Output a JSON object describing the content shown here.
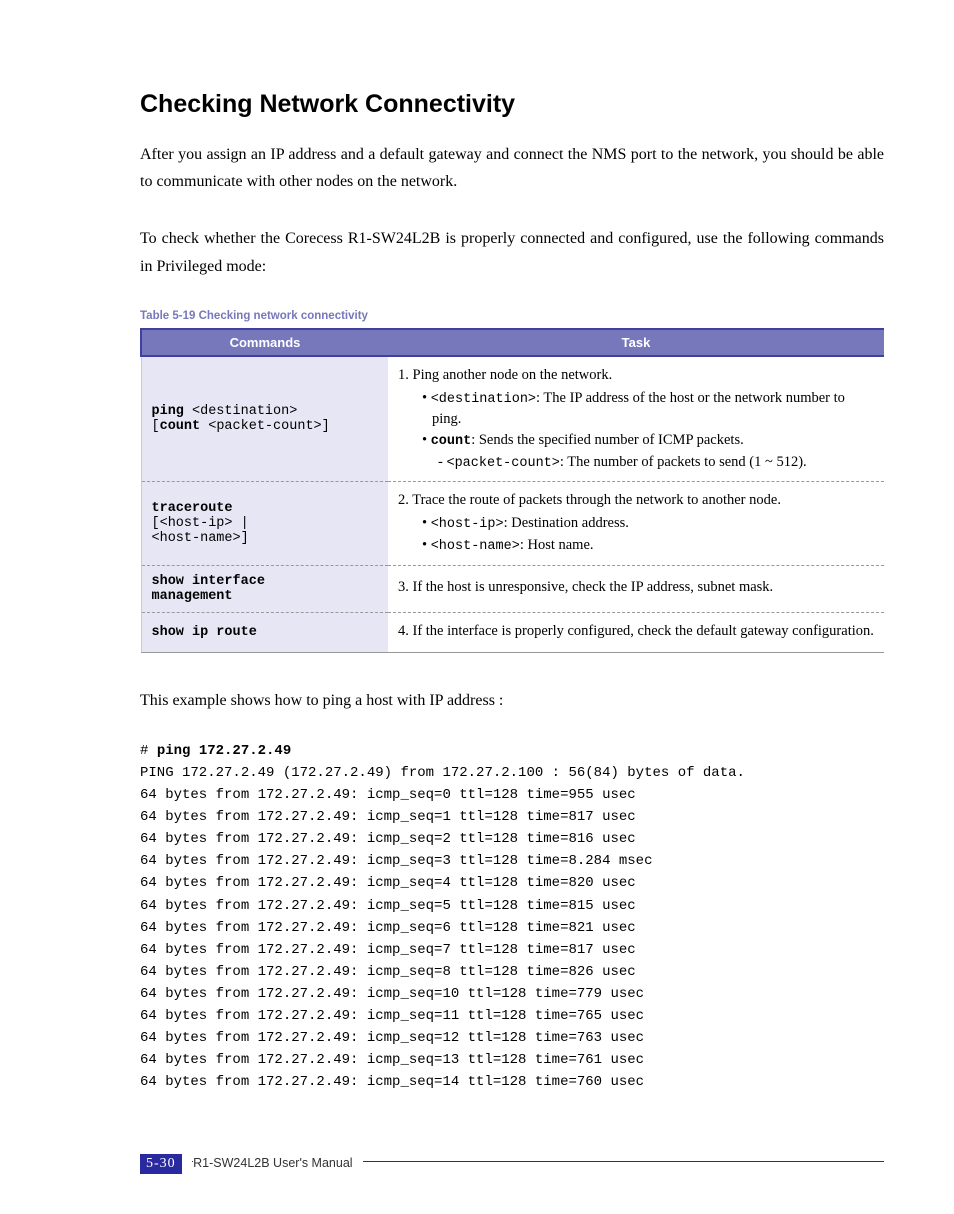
{
  "heading": "Checking Network Connectivity",
  "para1": "After you assign an IP address and a default gateway and connect the NMS port to the network, you should be able to communicate with other nodes on the network.",
  "para2": "To check whether the Corecess R1-SW24L2B is properly connected and configured, use the following commands in Privileged mode:",
  "tableCaption": "Table 5-19   Checking network connectivity",
  "th1": "Commands",
  "th2": "Task",
  "row1": {
    "cmd_b1": "ping",
    "cmd_t1": " <destination>",
    "cmd_t2": "[",
    "cmd_b2": "count",
    "cmd_t3": " <packet-count>]",
    "task_main": "1. Ping another node on the network.",
    "b1_code": "<destination>",
    "b1_text": ": The IP address of the host or the network number to ping.",
    "b2_code": "count",
    "b2_text": ": Sends the specified number of ICMP packets.",
    "s1_code": "<packet-count>",
    "s1_text": ": The number of packets to send (1 ~ 512)."
  },
  "row2": {
    "cmd_b1": "traceroute",
    "cmd_t1": "[<host-ip> |",
    "cmd_t2": "<host-name>]",
    "task_main": "2. Trace the route of packets through the network to another node.",
    "b1_code": "<host-ip>",
    "b1_text": ": Destination address.",
    "b2_code": "<host-name>",
    "b2_text": ": Host name."
  },
  "row3": {
    "cmd_b1": "show interface",
    "cmd_b2": "management",
    "task_main": "3. If the host is unresponsive, check the IP address, subnet mask."
  },
  "row4": {
    "cmd_b1": "show ip route",
    "task_main": "4. If the interface is properly configured, check the default gateway configuration."
  },
  "para3": "This example shows how to ping a host with IP address                        :",
  "term_prompt": "# ",
  "term_cmd": "ping 172.27.2.49",
  "term_lines": [
    "PING 172.27.2.49 (172.27.2.49) from 172.27.2.100 : 56(84) bytes of data.",
    "64 bytes from 172.27.2.49: icmp_seq=0 ttl=128 time=955 usec",
    "64 bytes from 172.27.2.49: icmp_seq=1 ttl=128 time=817 usec",
    "64 bytes from 172.27.2.49: icmp_seq=2 ttl=128 time=816 usec",
    "64 bytes from 172.27.2.49: icmp_seq=3 ttl=128 time=8.284 msec",
    "64 bytes from 172.27.2.49: icmp_seq=4 ttl=128 time=820 usec",
    "64 bytes from 172.27.2.49: icmp_seq=5 ttl=128 time=815 usec",
    "64 bytes from 172.27.2.49: icmp_seq=6 ttl=128 time=821 usec",
    "64 bytes from 172.27.2.49: icmp_seq=7 ttl=128 time=817 usec",
    "64 bytes from 172.27.2.49: icmp_seq=8 ttl=128 time=826 usec",
    "64 bytes from 172.27.2.49: icmp_seq=10 ttl=128 time=779 usec",
    "64 bytes from 172.27.2.49: icmp_seq=11 ttl=128 time=765 usec",
    "64 bytes from 172.27.2.49: icmp_seq=12 ttl=128 time=763 usec",
    "64 bytes from 172.27.2.49: icmp_seq=13 ttl=128 time=761 usec",
    "64 bytes from 172.27.2.49: icmp_seq=14 ttl=128 time=760 usec"
  ],
  "footer": {
    "page": "5-30",
    "doc": "R1-SW24L2B   User's Manual"
  }
}
